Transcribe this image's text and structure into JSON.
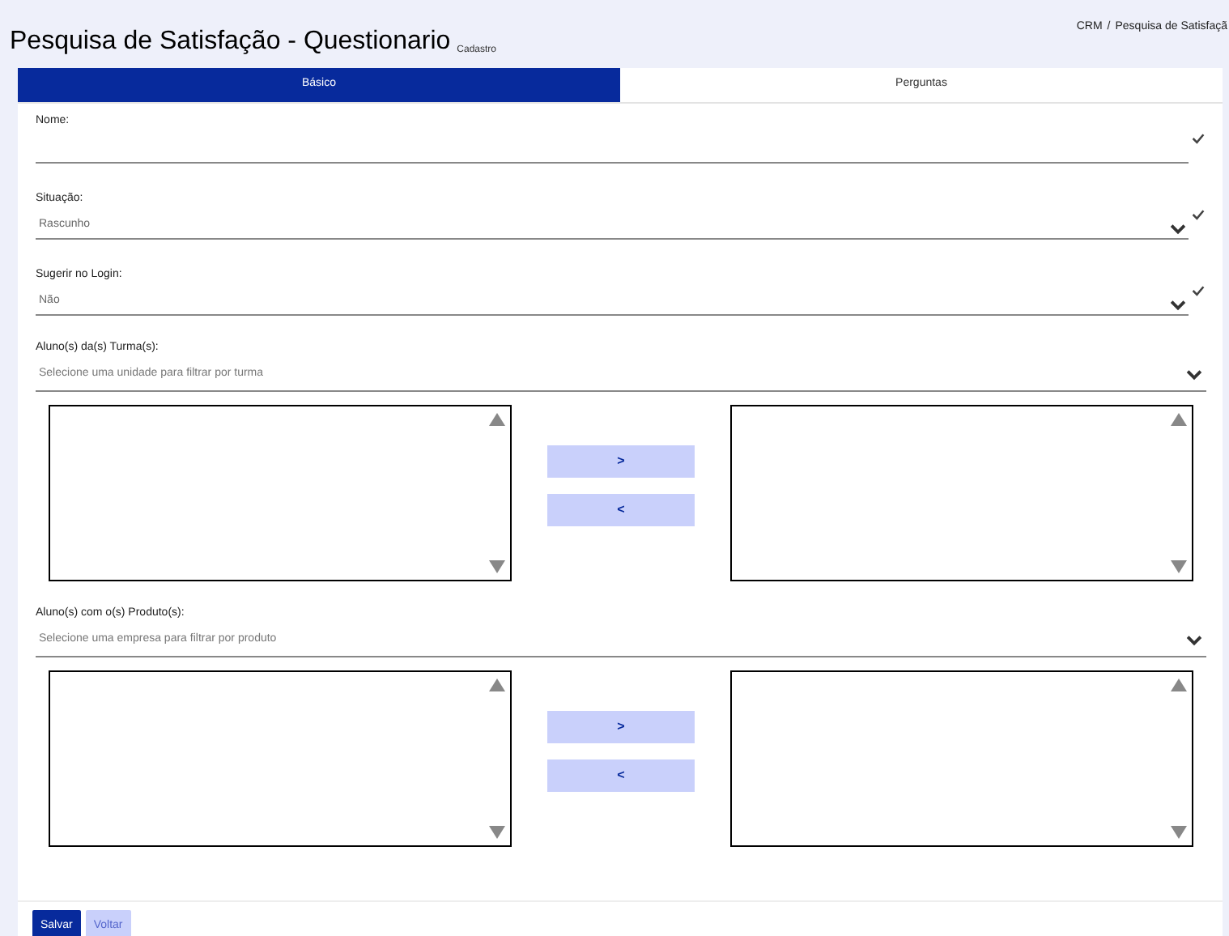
{
  "header": {
    "title": "Pesquisa de Satisfação - Questionario",
    "subtitle": "Cadastro",
    "breadcrumb": [
      "CRM",
      "Pesquisa de Satisfaçã"
    ],
    "separator": "/"
  },
  "tabs": [
    {
      "label": "Básico",
      "selected": true
    },
    {
      "label": "Perguntas",
      "selected": false
    }
  ],
  "fields": [
    {
      "kind": "text",
      "label": "Nome:",
      "validated": true
    },
    {
      "kind": "select",
      "label": "Situação:",
      "value": "Rascunho",
      "validated": true
    },
    {
      "kind": "select",
      "label": "Sugerir no Login:",
      "value": "Não",
      "validated": true
    },
    {
      "kind": "transfer",
      "label": "Aluno(s) da(s) Turma(s):",
      "placeholder": "Selecione uma unidade para filtrar por turma",
      "validated": false,
      "buttons": [
        ">",
        "<"
      ]
    },
    {
      "kind": "transfer",
      "label": "Aluno(s) com o(s) Produto(s):",
      "placeholder": "Selecione uma empresa para filtrar por produto",
      "validated": false,
      "buttons": [
        ">",
        "<"
      ]
    }
  ],
  "buttons": [
    {
      "label": "Salvar",
      "kind": "primary"
    },
    {
      "label": "Voltar",
      "kind": "secondary"
    }
  ]
}
